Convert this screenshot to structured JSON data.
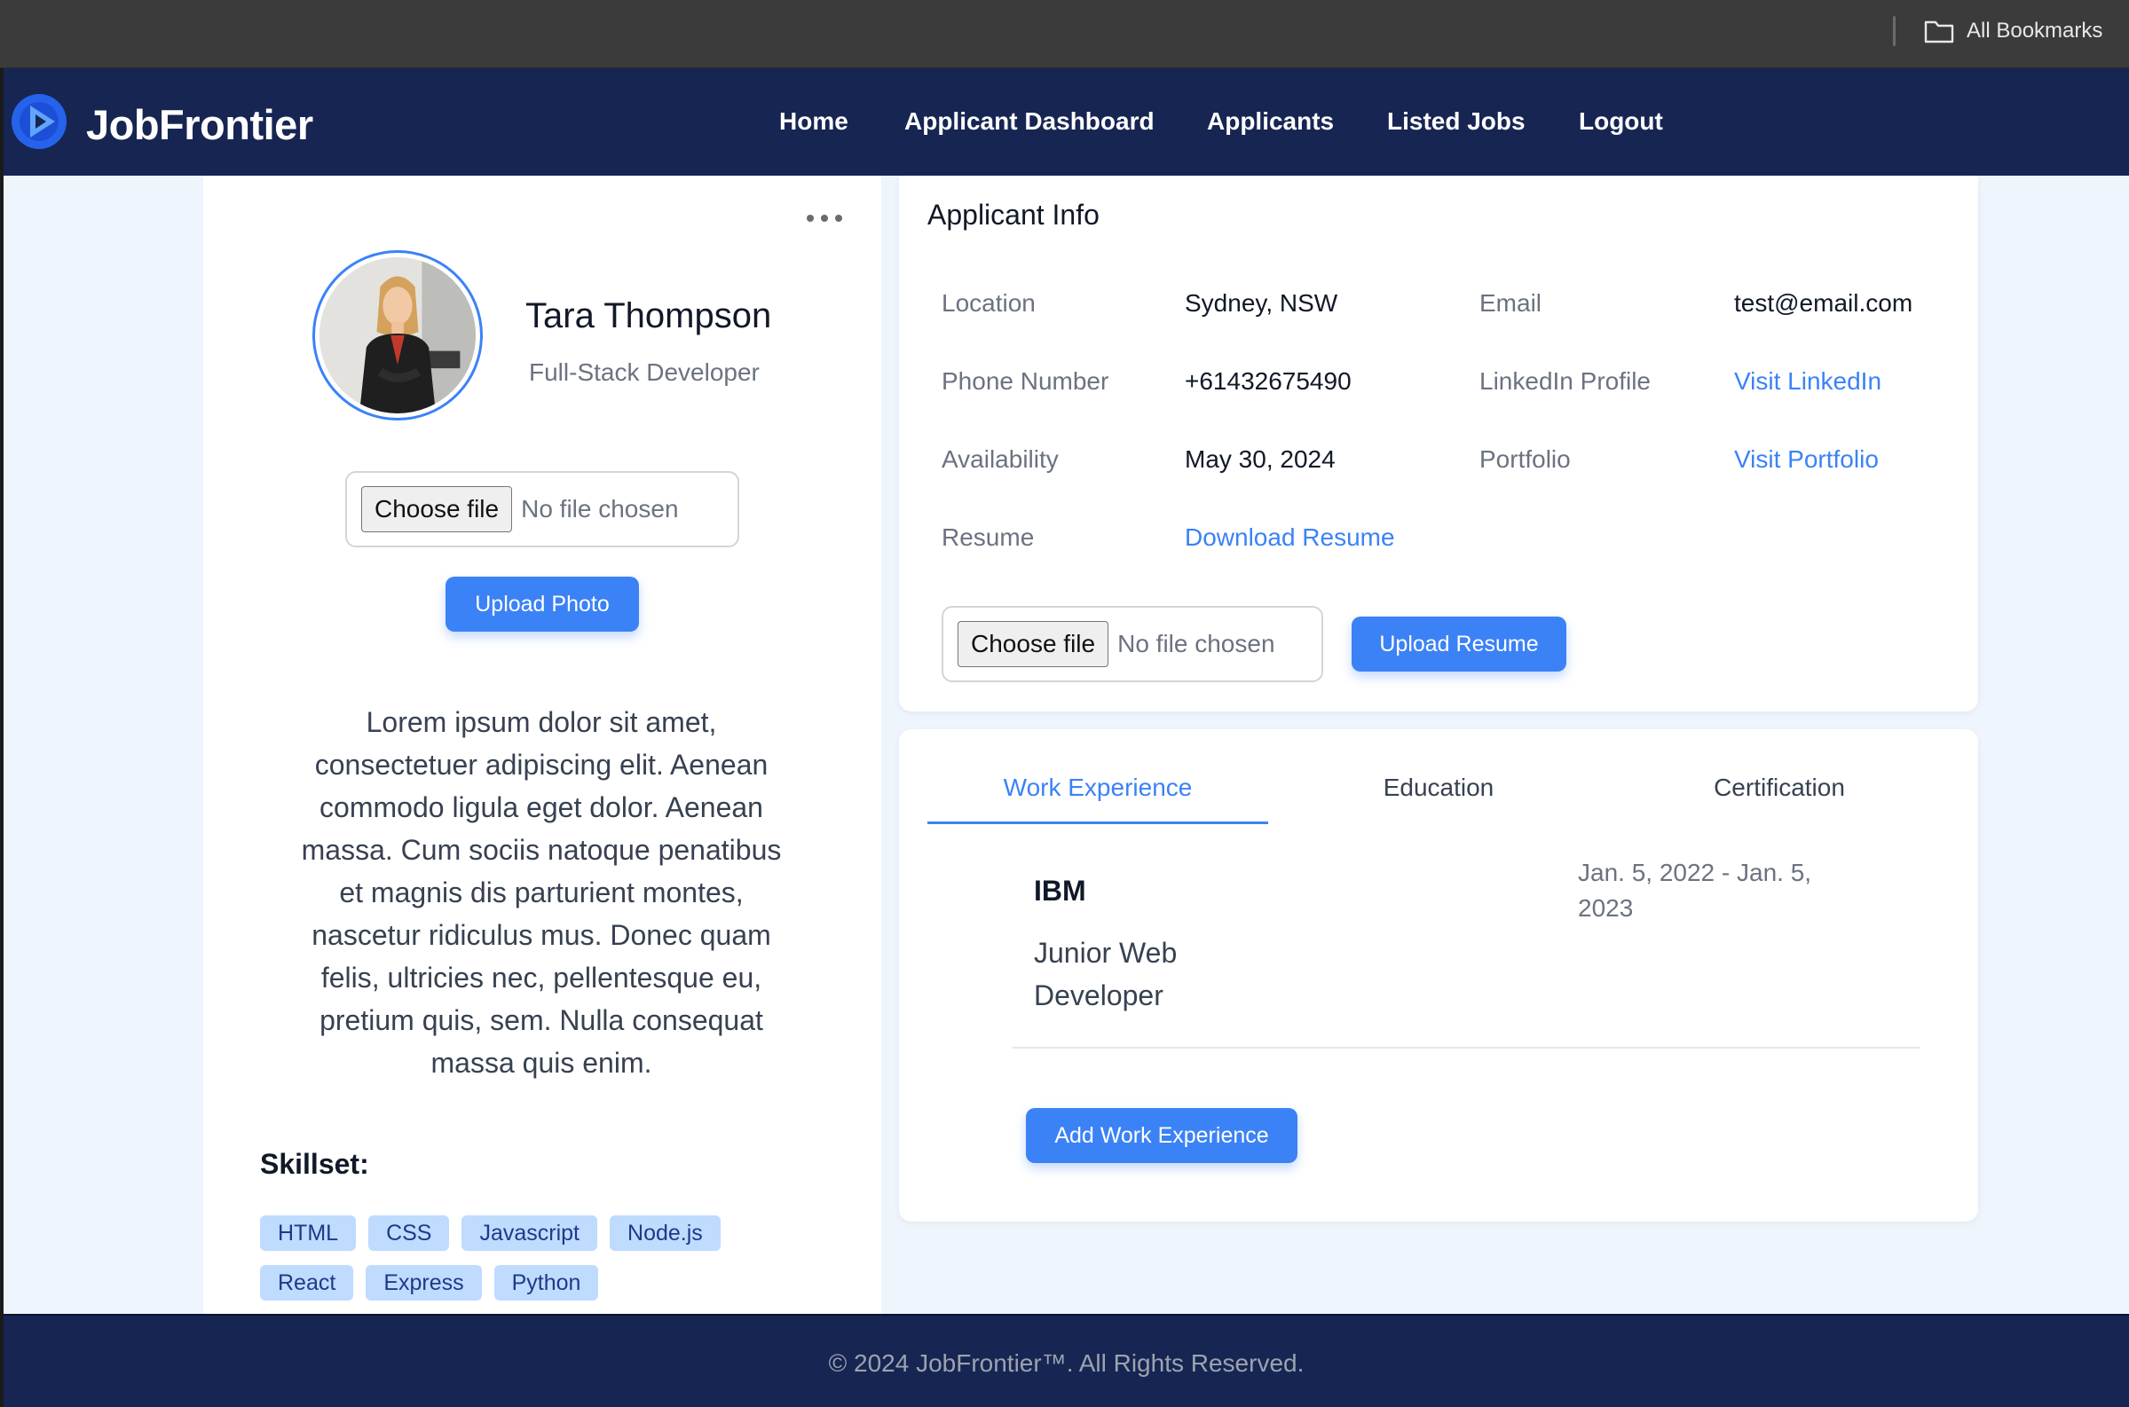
{
  "browser": {
    "bookmarks_label": "All Bookmarks",
    "folder_icon": "folder-icon"
  },
  "navbar": {
    "brand": "JobFrontier",
    "logo_icon": "jobfrontier-logo-icon",
    "links": [
      "Home",
      "Applicant Dashboard",
      "Applicants",
      "Listed Jobs",
      "Logout"
    ]
  },
  "profile": {
    "name": "Tara Thompson",
    "title": "Full-Stack Developer",
    "photo_file": {
      "button": "Choose file",
      "status": "No file chosen"
    },
    "upload_photo_label": "Upload Photo",
    "bio": "Lorem ipsum dolor sit amet, consectetuer adipiscing elit. Aenean commodo ligula eget dolor. Aenean massa. Cum sociis natoque penatibus et magnis dis parturient montes, nascetur ridiculus mus. Donec quam felis, ultricies nec, pellentesque eu, pretium quis, sem. Nulla consequat massa quis enim.",
    "skillset_title": "Skillset:",
    "skills": [
      "HTML",
      "CSS",
      "Javascript",
      "Node.js",
      "React",
      "Express",
      "Python"
    ]
  },
  "applicant_info": {
    "heading": "Applicant Info",
    "location_label": "Location",
    "location": "Sydney, NSW",
    "email_label": "Email",
    "email": "test@email.com",
    "phone_label": "Phone Number",
    "phone": "+61432675490",
    "linkedin_label": "LinkedIn Profile",
    "linkedin_link": "Visit LinkedIn",
    "availability_label": "Availability",
    "availability": "May 30, 2024",
    "portfolio_label": "Portfolio",
    "portfolio_link": "Visit Portfolio",
    "resume_label": "Resume",
    "resume_link": "Download Resume",
    "resume_file": {
      "button": "Choose file",
      "status": "No file chosen"
    },
    "upload_resume_label": "Upload Resume"
  },
  "experience": {
    "tabs": [
      "Work Experience",
      "Education",
      "Certification"
    ],
    "active_tab": "Work Experience",
    "items": [
      {
        "company": "IBM",
        "role": "Junior Web Developer",
        "dates": "Jan. 5, 2022 - Jan. 5, 2023"
      }
    ],
    "add_label": "Add Work Experience"
  },
  "footer": {
    "text": "© 2024 JobFrontier™. All Rights Reserved."
  },
  "colors": {
    "navy": "#172553",
    "accent": "#3b82f6",
    "page_bg": "#eff5fd",
    "skill_tag_bg": "#bfdbfe"
  }
}
